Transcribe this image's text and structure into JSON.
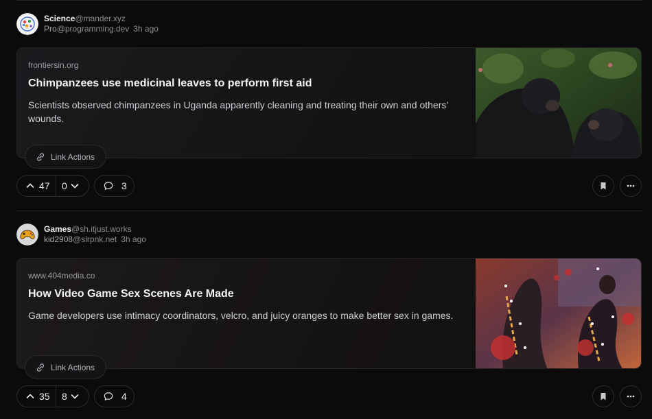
{
  "posts": [
    {
      "community": "Science",
      "community_instance": "@mander.xyz",
      "user": "Pro",
      "user_instance": "@programming.dev",
      "time": "3h ago",
      "domain": "frontiersin.org",
      "title": "Chimpanzees use medicinal leaves to perform first aid",
      "description": "Scientists observed chimpanzees in Uganda apparently cleaning and treating their own and others’ wounds.",
      "link_actions_label": "Link Actions",
      "upvotes": "47",
      "downvotes": "0",
      "comments": "3"
    },
    {
      "community": "Games",
      "community_instance": "@sh.itjust.works",
      "user": "kid2908",
      "user_instance": "@slrpnk.net",
      "time": "3h ago",
      "domain": "www.404media.co",
      "title": "How Video Game Sex Scenes Are Made",
      "description": "Game developers use intimacy coordinators, velcro, and juicy oranges to make better sex in games.",
      "link_actions_label": "Link Actions",
      "upvotes": "35",
      "downvotes": "8",
      "comments": "4"
    }
  ],
  "icons": {
    "upvote": "chevron-up-icon",
    "downvote": "chevron-down-icon",
    "comment": "speech-bubble-icon",
    "link": "link-icon",
    "bookmark": "bookmark-icon",
    "more": "ellipsis-icon"
  },
  "colors": {
    "background": "#0b0b0c",
    "border": "#2c2c30",
    "text_primary": "#f4f4f6",
    "text_muted": "#8d8d93"
  }
}
